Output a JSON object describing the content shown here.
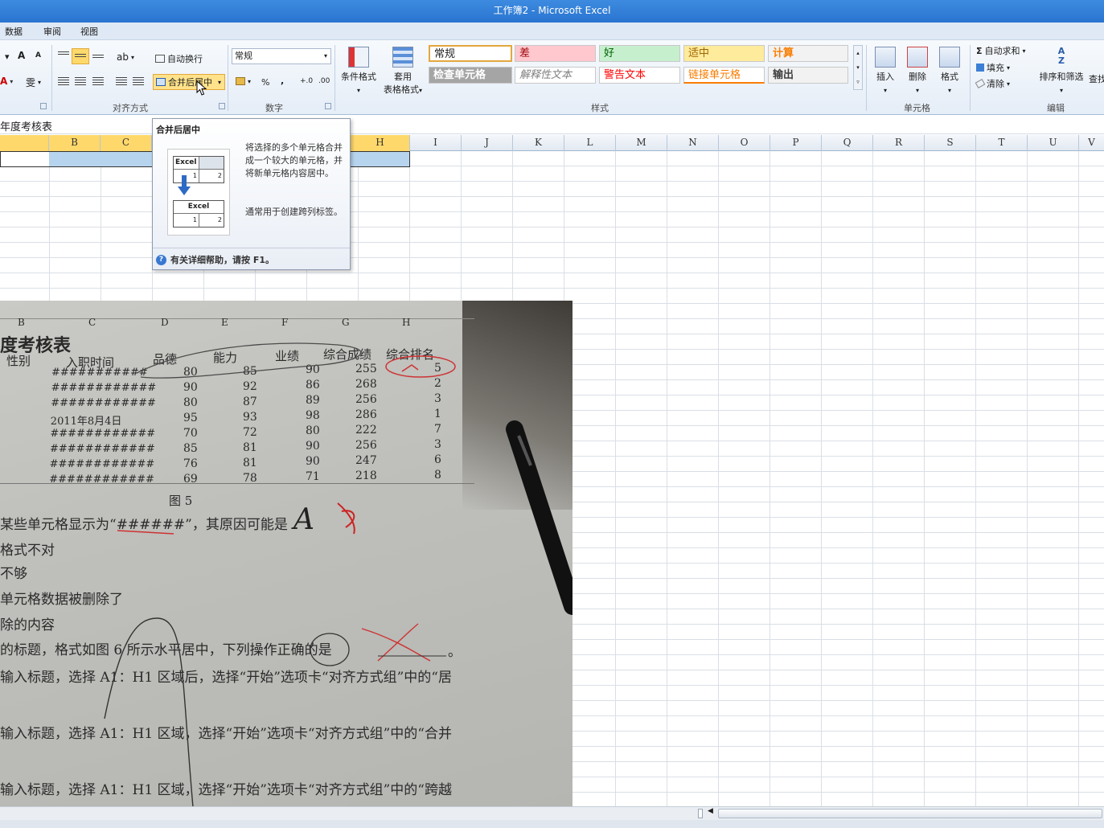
{
  "window": {
    "title": "工作簿2 - Microsoft Excel"
  },
  "menu": {
    "items": [
      "数据",
      "审阅",
      "视图"
    ]
  },
  "ribbon": {
    "font": {
      "increase": "A",
      "decrease": "A",
      "wen": "雯"
    },
    "alignment": {
      "wrap_text": "自动换行",
      "merge_center": "合并后居中",
      "group_label": "对齐方式"
    },
    "number": {
      "format_value": "常规",
      "percent": "%",
      "comma": ",",
      "inc_dec": "+.0",
      "dec_dec": ".00",
      "group_label": "数字"
    },
    "styles": {
      "conditional": "条件格式",
      "table_line1": "套用",
      "table_line2": "表格格式",
      "group_label": "样式",
      "cells": [
        {
          "text": "常规",
          "bg": "#ffffff",
          "color": "#222222"
        },
        {
          "text": "差",
          "bg": "#ffc7ce",
          "color": "#9c0006"
        },
        {
          "text": "好",
          "bg": "#c6efce",
          "color": "#006100"
        },
        {
          "text": "适中",
          "bg": "#ffeb9c",
          "color": "#9c6500"
        },
        {
          "text": "计算",
          "bg": "#f2f2f2",
          "color": "#fa7d00"
        },
        {
          "text": "检查单元格",
          "bg": "#a5a5a5",
          "color": "#ffffff"
        },
        {
          "text": "解释性文本",
          "bg": "#ffffff",
          "color": "#7f7f7f"
        },
        {
          "text": "警告文本",
          "bg": "#ffffff",
          "color": "#ff0000"
        },
        {
          "text": "链接单元格",
          "bg": "#ffffff",
          "color": "#fa7d00"
        },
        {
          "text": "输出",
          "bg": "#f2f2f2",
          "color": "#3f3f3f"
        }
      ]
    },
    "cells": {
      "insert": "插入",
      "delete": "删除",
      "format": "格式",
      "group_label": "单元格"
    },
    "editing": {
      "autosum": "自动求和",
      "fill": "填充",
      "clear": "清除",
      "sort": "排序和筛选",
      "find": "查找",
      "group_label": "编辑"
    }
  },
  "formula_bar": {
    "content": "年度考核表"
  },
  "columns": [
    "B",
    "C",
    "H",
    "I",
    "J",
    "K",
    "L",
    "M",
    "N",
    "O",
    "P",
    "Q",
    "R",
    "S",
    "T",
    "U",
    "V"
  ],
  "tooltip": {
    "title": "合并后居中",
    "desc1": "将选择的多个单元格合并成一个较大的单元格，并将新单元格内容居中。",
    "desc2": "通常用于创建跨列标签。",
    "help": "有关详细帮助，请按 F1。",
    "demo_word": "Excel",
    "demo_1": "1",
    "demo_2": "2"
  },
  "photo": {
    "col_letters": [
      "B",
      "C",
      "D",
      "E",
      "F",
      "G",
      "H"
    ],
    "title": "度考核表",
    "headers": [
      "性别",
      "入职时间",
      "品德",
      "能力",
      "业绩",
      "综合成绩",
      "综合排名"
    ],
    "rows": [
      [
        "###########",
        "80",
        "85",
        "90",
        "255",
        "5"
      ],
      [
        "############",
        "90",
        "92",
        "86",
        "268",
        "2"
      ],
      [
        "############",
        "80",
        "87",
        "89",
        "256",
        "3"
      ],
      [
        "2011年8月4日",
        "95",
        "93",
        "98",
        "286",
        "1"
      ],
      [
        "############",
        "70",
        "72",
        "80",
        "222",
        "7"
      ],
      [
        "############",
        "85",
        "81",
        "90",
        "256",
        "3"
      ],
      [
        "############",
        "76",
        "81",
        "90",
        "247",
        "6"
      ],
      [
        "############",
        "69",
        "78",
        "71",
        "218",
        "8"
      ]
    ],
    "figure_label": "图 5",
    "lines": [
      "某些单元格显示为“######”，其原因可能是",
      "格式不对",
      "不够",
      "单元格数据被删除了",
      "除的内容",
      "的标题，格式如图 6 所示水平居中，下列操作正确的是",
      "输入标题，选择 A1：H1 区域后，选择“开始”选项卡“对齐方式组”中的“居",
      "输入标题，选择 A1：H1 区域，选择“开始”选项卡“对齐方式组”中的“合并",
      "输入标题，选择 A1：H1 区域，选择“开始”选项卡“对齐方式组”中的“跨越"
    ],
    "answer_mark": "A",
    "period": "。"
  },
  "colors": {
    "accent": "#2a74d0",
    "highlight": "#ffe28a",
    "selection": "#b7d4ee"
  }
}
